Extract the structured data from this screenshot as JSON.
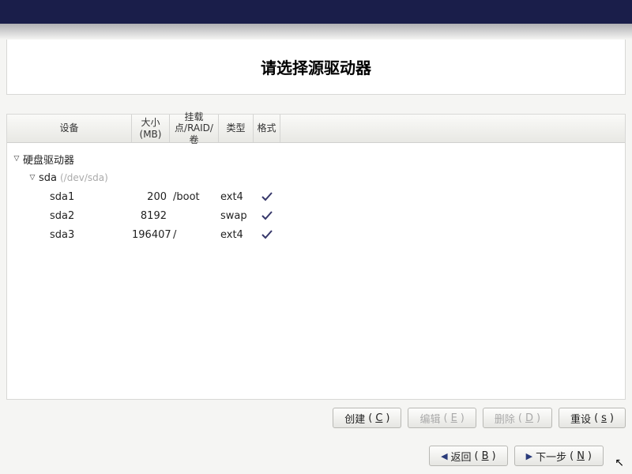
{
  "title": "请选择源驱动器",
  "columns": {
    "device": "设备",
    "size": "大小(MB)",
    "mount": "挂载点/RAID/卷",
    "type": "类型",
    "format": "格式"
  },
  "tree": {
    "root_label": "硬盘驱动器",
    "disk": {
      "name": "sda",
      "path": "(/dev/sda)"
    },
    "partitions": [
      {
        "name": "sda1",
        "size": "200",
        "mount": "/boot",
        "type": "ext4",
        "format": true
      },
      {
        "name": "sda2",
        "size": "8192",
        "mount": "",
        "type": "swap",
        "format": true
      },
      {
        "name": "sda3",
        "size": "196407",
        "mount": "/",
        "type": "ext4",
        "format": true
      }
    ]
  },
  "buttons": {
    "create": {
      "label": "创建",
      "mn": "C"
    },
    "edit": {
      "label": "编辑",
      "mn": "E"
    },
    "delete": {
      "label": "删除 ",
      "mn": "D"
    },
    "reset": {
      "label": "重设",
      "mn": "s"
    },
    "back": {
      "label": "返回 ",
      "mn": "B"
    },
    "next": {
      "label": "下一步 ",
      "mn": "N"
    }
  }
}
